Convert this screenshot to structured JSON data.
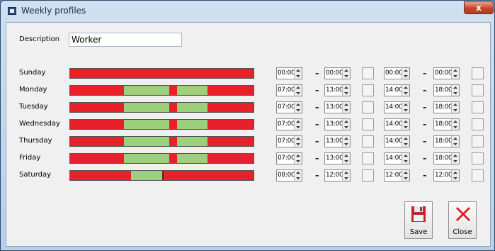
{
  "window": {
    "title": "Weekly profiles",
    "close_glyph": "x"
  },
  "description": {
    "label": "Description",
    "value": "Worker"
  },
  "days": [
    {
      "name": "Sunday",
      "times": [
        "00:00",
        "00:00",
        "00:00",
        "00:00"
      ]
    },
    {
      "name": "Monday",
      "times": [
        "07:00",
        "13:00",
        "14:00",
        "18:00"
      ]
    },
    {
      "name": "Tuesday",
      "times": [
        "07:00",
        "13:00",
        "14:00",
        "18:00"
      ]
    },
    {
      "name": "Wednesday",
      "times": [
        "07:00",
        "13:00",
        "14:00",
        "18:00"
      ]
    },
    {
      "name": "Thursday",
      "times": [
        "07:00",
        "13:00",
        "14:00",
        "18:00"
      ]
    },
    {
      "name": "Friday",
      "times": [
        "07:00",
        "13:00",
        "14:00",
        "18:00"
      ]
    },
    {
      "name": "Saturday",
      "times": [
        "08:00",
        "12:00",
        "12:00",
        "12:00"
      ]
    }
  ],
  "colors": {
    "inactive": "#e8202a",
    "active": "#9dd07a"
  },
  "buttons": {
    "save": "Save",
    "close": "Close"
  },
  "icons": {
    "save": "floppy-disk-icon",
    "close": "red-x-icon"
  }
}
